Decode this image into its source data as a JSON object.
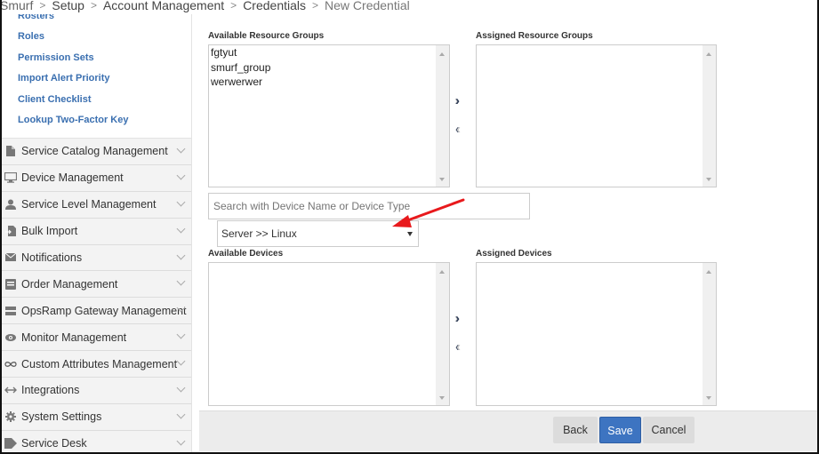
{
  "breadcrumb": [
    "Smurf",
    "Setup",
    "Account Management",
    "Credentials",
    "New Credential"
  ],
  "sidebar": {
    "sub_items": [
      {
        "label": "Rosters",
        "icon": ""
      },
      {
        "label": "Roles"
      },
      {
        "label": "Permission Sets"
      },
      {
        "label": "Import Alert Priority"
      },
      {
        "label": "Client Checklist"
      },
      {
        "label": "Lookup Two-Factor Key"
      }
    ],
    "items": [
      {
        "label": "Service Catalog Management",
        "icon": "document-icon"
      },
      {
        "label": "Device Management",
        "icon": "monitor-icon"
      },
      {
        "label": "Service Level Management",
        "icon": "user-icon"
      },
      {
        "label": "Bulk Import",
        "icon": "import-icon"
      },
      {
        "label": "Notifications",
        "icon": "envelope-icon"
      },
      {
        "label": "Order Management",
        "icon": "order-icon"
      },
      {
        "label": "OpsRamp Gateway Management",
        "icon": "gateway-icon"
      },
      {
        "label": "Monitor Management",
        "icon": "eye-icon"
      },
      {
        "label": "Custom Attributes Management",
        "icon": "infinity-icon"
      },
      {
        "label": "Integrations",
        "icon": "integrations-icon"
      },
      {
        "label": "System Settings",
        "icon": "gear-icon"
      },
      {
        "label": "Service Desk",
        "icon": "tag-icon"
      }
    ]
  },
  "resource_groups": {
    "available_label": "Available Resource Groups",
    "assigned_label": "Assigned Resource Groups",
    "available": [
      "fgtyut",
      "smurf_group",
      "werwerwer"
    ],
    "assigned": []
  },
  "devices": {
    "search_placeholder": "Search with Device Name or Device Type",
    "device_type_selected": "Server >> Linux",
    "available_label": "Available Devices",
    "assigned_label": "Assigned Devices",
    "available": [],
    "assigned": []
  },
  "move": {
    "add": "»",
    "remove": "«"
  },
  "footer": {
    "back": "Back",
    "save": "Save",
    "cancel": "Cancel"
  },
  "colors": {
    "primary": "#3d74c1",
    "link": "#3a6fb0",
    "annotation_arrow": "#e8191c"
  }
}
